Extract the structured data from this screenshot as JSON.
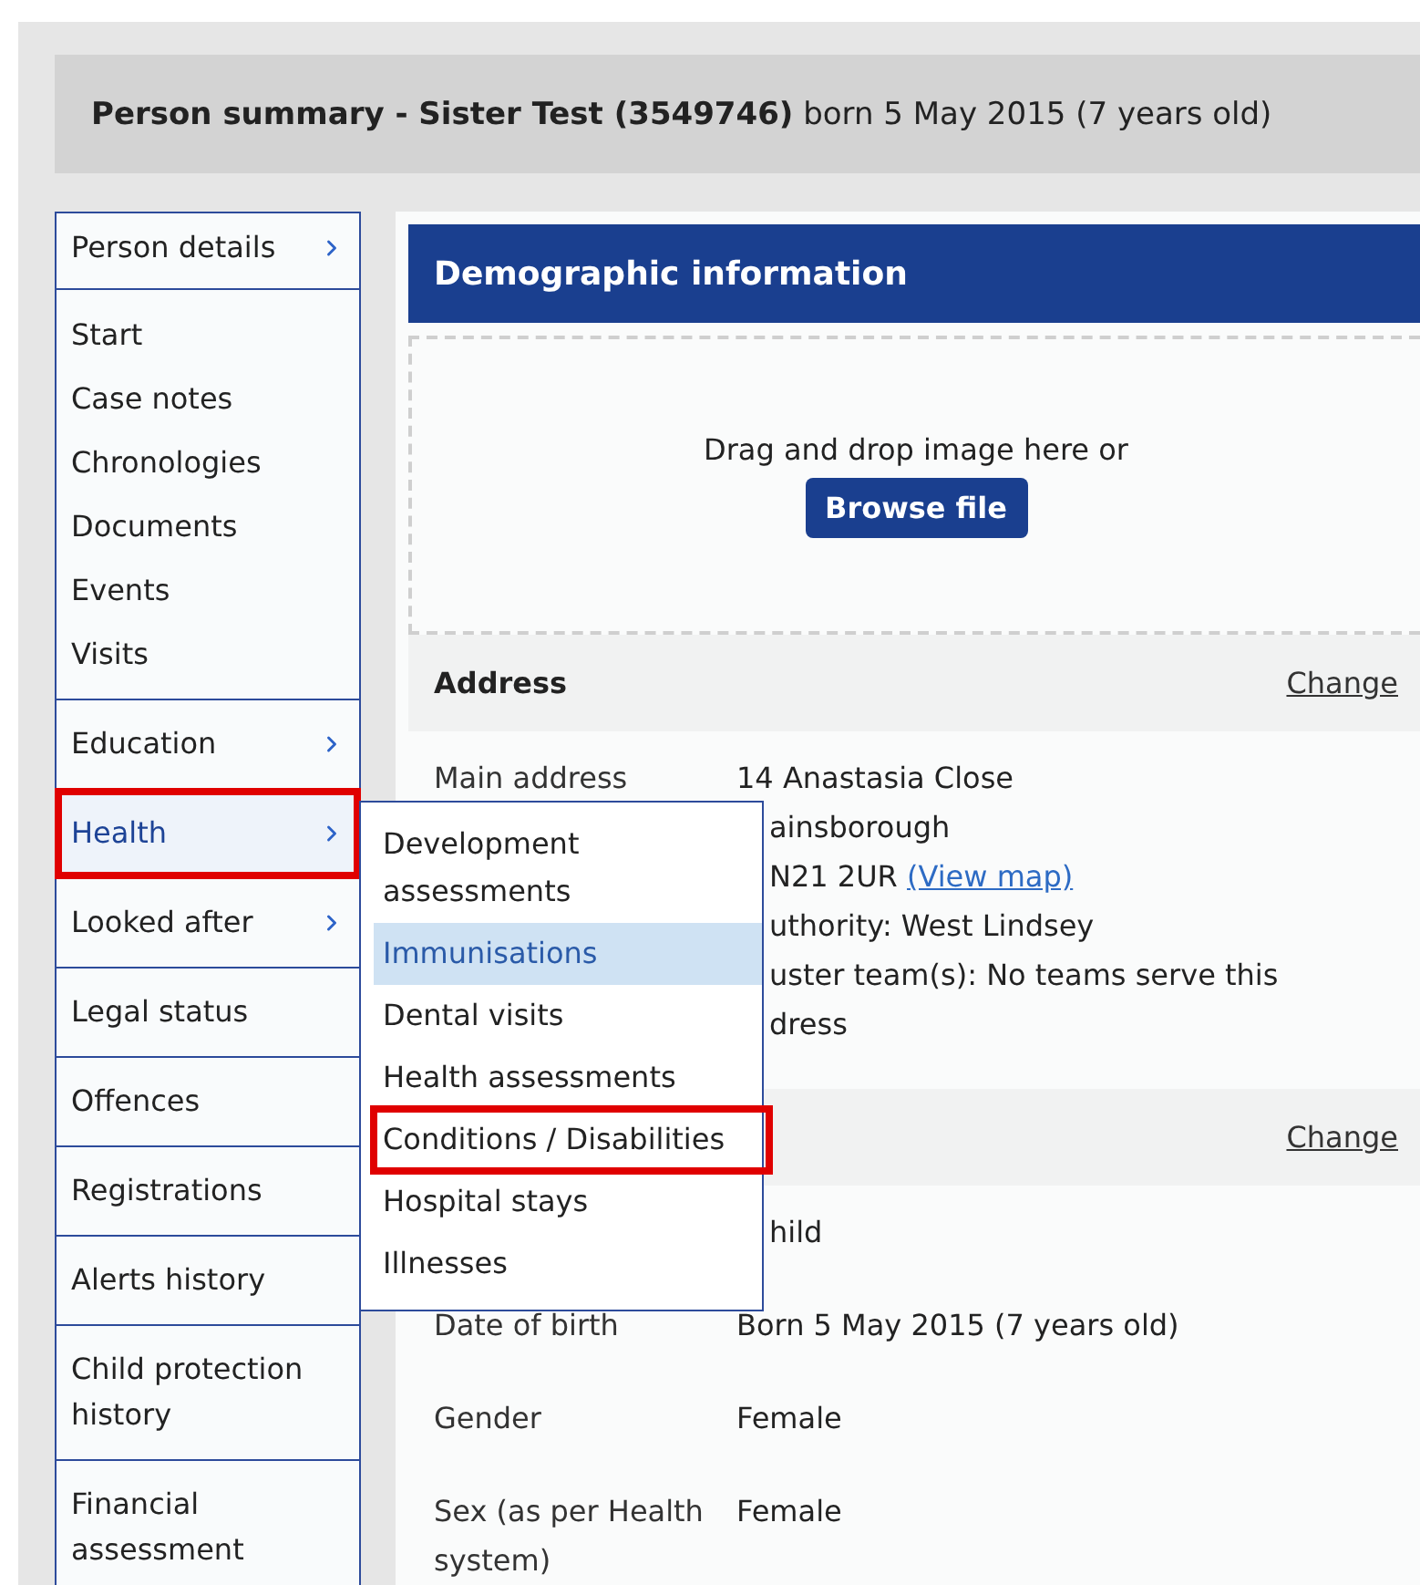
{
  "header": {
    "title": "**Person summary - Sister Test (3549746)** born 5 May 2015 (7 years old)"
  },
  "sidebar": {
    "groups": [
      {
        "items": [
          {
            "label": "Person details",
            "submenu": true,
            "selected": false,
            "highlighted": false
          }
        ]
      },
      {
        "items": [
          {
            "label": "Start",
            "submenu": false,
            "selected": false,
            "highlighted": false
          },
          {
            "label": "Case notes",
            "submenu": false,
            "selected": false,
            "highlighted": false
          },
          {
            "label": "Chronologies",
            "submenu": false,
            "selected": false,
            "highlighted": false
          },
          {
            "label": "Documents",
            "submenu": false,
            "selected": false,
            "highlighted": false
          },
          {
            "label": "Events",
            "submenu": false,
            "selected": false,
            "highlighted": false
          },
          {
            "label": "Visits",
            "submenu": false,
            "selected": false,
            "highlighted": false
          }
        ]
      },
      {
        "items": [
          {
            "label": "Education",
            "submenu": true,
            "selected": false,
            "highlighted": false
          }
        ]
      },
      {
        "items": [
          {
            "label": "Health",
            "submenu": true,
            "selected": true,
            "highlighted": true
          }
        ]
      },
      {
        "items": [
          {
            "label": "Looked after",
            "submenu": true,
            "selected": false,
            "highlighted": false
          }
        ]
      },
      {
        "items": [
          {
            "label": "Legal status",
            "submenu": false,
            "selected": false,
            "highlighted": false
          }
        ]
      },
      {
        "items": [
          {
            "label": "Offences",
            "submenu": false,
            "selected": false,
            "highlighted": false
          }
        ]
      },
      {
        "items": [
          {
            "label": "Registrations",
            "submenu": false,
            "selected": false,
            "highlighted": false
          }
        ]
      },
      {
        "items": [
          {
            "label": "Alerts history",
            "submenu": false,
            "selected": false,
            "highlighted": false
          }
        ]
      },
      {
        "items": [
          {
            "label": "Child protection history",
            "submenu": false,
            "selected": false,
            "highlighted": false
          }
        ]
      },
      {
        "items": [
          {
            "label": "Financial assessment",
            "submenu": false,
            "selected": false,
            "highlighted": false
          }
        ]
      }
    ]
  },
  "submenu": {
    "items": [
      {
        "label": "Development assessments",
        "selected": false,
        "highlighted": false
      },
      {
        "label": "Immunisations",
        "selected": true,
        "highlighted": false
      },
      {
        "label": "Dental visits",
        "selected": false,
        "highlighted": false
      },
      {
        "label": "Health assessments",
        "selected": false,
        "highlighted": false
      },
      {
        "label": "Conditions / Disabilities",
        "selected": false,
        "highlighted": true
      },
      {
        "label": "Hospital stays",
        "selected": false,
        "highlighted": false
      },
      {
        "label": "Illnesses",
        "selected": false,
        "highlighted": false
      }
    ]
  },
  "panel": {
    "title": "Demographic information",
    "dropzone": {
      "text": "Drag and drop image here or",
      "button": "Browse file"
    },
    "sections": [
      {
        "heading": "Address",
        "action": "Change",
        "rows": [
          {
            "label": "Main address",
            "lines": [
              {
                "kind": "full",
                "text": "14 Anastasia Close"
              },
              {
                "kind": "clipped",
                "text": "ainsborough"
              },
              {
                "kind": "clipped",
                "text": "N21 2UR",
                "link": "(View map)"
              },
              {
                "kind": "clipped",
                "text": "uthority: West Lindsey"
              },
              {
                "kind": "clipped",
                "text": "uster team(s): No teams serve this"
              },
              {
                "kind": "clipped",
                "text": "dress"
              }
            ]
          }
        ]
      },
      {
        "action": "Change",
        "rows": [
          {
            "lines": [
              {
                "kind": "clipped",
                "text": "hild"
              }
            ]
          },
          {
            "label": "Date of birth",
            "lines": [
              {
                "kind": "full",
                "text": "Born 5 May 2015 (7 years old)"
              }
            ]
          },
          {
            "label": "Gender",
            "lines": [
              {
                "kind": "full",
                "text": "Female"
              }
            ]
          },
          {
            "label": "Sex (as per\nHealth system)",
            "lines": [
              {
                "kind": "full",
                "text": "Female"
              }
            ]
          }
        ]
      }
    ]
  }
}
